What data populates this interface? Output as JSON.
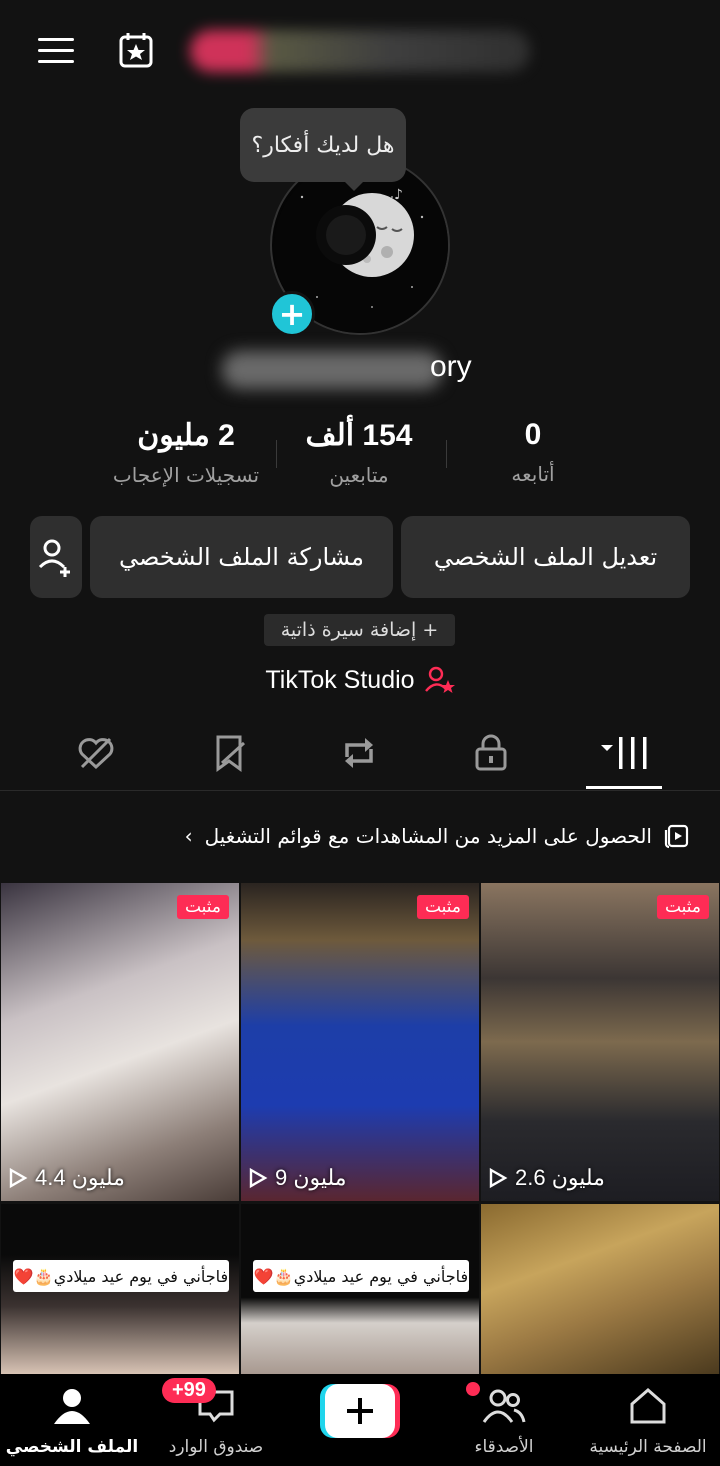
{
  "header": {
    "menu_icon": "hamburger-menu-icon",
    "calendar_icon": "calendar-star-icon"
  },
  "profile": {
    "tooltip": "هل لديك أفكار؟",
    "username_visible": "ory",
    "add_avatar_symbol": "+"
  },
  "stats": [
    {
      "value": "0",
      "label": "أتابعه"
    },
    {
      "value": "154 ألف",
      "label": "متابعين"
    },
    {
      "value": "2 مليون",
      "label": "تسجيلات الإعجاب"
    }
  ],
  "actions": {
    "edit_profile": "تعديل الملف الشخصي",
    "share_profile": "مشاركة الملف الشخصي",
    "add_bio": "+ إضافة سيرة ذاتية",
    "studio": "TikTok Studio"
  },
  "tabs": [
    {
      "name": "videos-grid",
      "icon": "grid-icon",
      "active": true
    },
    {
      "name": "private",
      "icon": "lock-icon"
    },
    {
      "name": "reposts",
      "icon": "repost-icon"
    },
    {
      "name": "favorites",
      "icon": "bookmark-icon"
    },
    {
      "name": "liked",
      "icon": "heart-hidden-icon"
    }
  ],
  "playlist_banner": "الحصول على المزيد من المشاهدات مع قوائم التشغيل",
  "videos": [
    {
      "pinned": "مثبت",
      "views": "4.4 مليون"
    },
    {
      "pinned": "مثبت",
      "views": "9 مليون"
    },
    {
      "pinned": "مثبت",
      "views": "2.6 مليون"
    },
    {
      "caption": "فاجأني في يوم عيد ميلادي🎂❤️"
    },
    {
      "caption": "فاجأني في يوم عيد ميلادي🎂❤️"
    },
    {
      "caption": ""
    }
  ],
  "bottom_nav": {
    "home": "الصفحة الرئيسية",
    "friends": "الأصدقاء",
    "inbox": "صندوق الوارد",
    "inbox_badge": "+99",
    "profile": "الملف الشخصي"
  },
  "colors": {
    "accent": "#fe2c55",
    "teal": "#20c5d7",
    "background": "#121212"
  }
}
